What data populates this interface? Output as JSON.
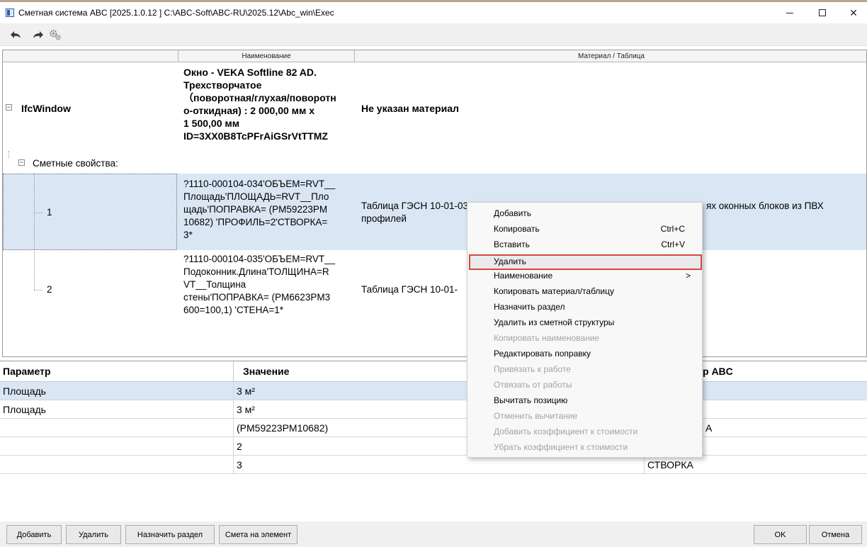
{
  "window": {
    "title": "Сметная система ABC [2025.1.0.12 ]   C:\\ABC-Soft\\ABC-RU\\2025.12\\Abc_win\\Exec",
    "app_icon": "abc-app-icon"
  },
  "toolbar": {
    "icons": [
      "undo-arrow-icon",
      "redo-arrow-icon",
      "gears-icon"
    ]
  },
  "tree_grid": {
    "columns": [
      "",
      "Наименование",
      "Материал / Таблица"
    ],
    "root": {
      "label": "IfcWindow",
      "name": "Окно - VEKA Softline 82 AD. Трехстворчатое (поворотная/глухая/поворотно-откидная) : 2 000,00 мм x 1 500,00 мм ID=3XX0B8TcPFrAiGSrVtTTMZ",
      "name_lines": [
        "Окно - VEKA Softline 82 AD.",
        "Трехстворчатое",
        "（поворотная/глухая/поворотн",
        "о-откидная) : 2 000,00 мм x",
        "1 500,00 мм",
        "ID=3XX0B8TcPFrAiGSrVtTTMZ"
      ],
      "material": "Не указан материал"
    },
    "group_label": "Сметные свойства:",
    "rows": [
      {
        "index": "1",
        "name_lines": [
          "?1110-000104-034'ОБЪЕМ=RVT__",
          "Площадь'ПЛОЩАДЬ=RVT__Пло",
          "щадь'ПОПРАВКА= (PM59223PM",
          "10682) 'ПРОФИЛЬ=2'СТВОРКА=",
          "3*"
        ],
        "material_lines": [
          "Таблица ГЭСН 10-01-034. У",
          "профилей"
        ],
        "material_right": "ях оконных блоков из ПВХ"
      },
      {
        "index": "2",
        "name_lines": [
          "?1110-000104-035'ОБЪЕМ=RVT__",
          "Подоконник.Длина'ТОЛЩИНА=R",
          "VT__Толщина",
          "стены'ПОПРАВКА= (PM6623PM3",
          "600=100,1) 'СТЕНА=1*"
        ],
        "material_lines": [
          "Таблица ГЭСН 10-01-"
        ]
      }
    ]
  },
  "param_grid": {
    "columns": [
      "Параметр",
      "Значение",
      "р ABC"
    ],
    "rows": [
      {
        "param": "Площадь",
        "value": "3 м²",
        "abc": ""
      },
      {
        "param": "Площадь",
        "value": "3 м²",
        "abc": ""
      },
      {
        "param": "",
        "value": " (PM59223PM10682)",
        "abc": "А"
      },
      {
        "param": "",
        "value": "2",
        "abc": ""
      },
      {
        "param": "",
        "value": "3",
        "abc": "СТВОРКА"
      }
    ]
  },
  "buttons": {
    "add": "Добавить",
    "delete": "Удалить",
    "assign_section": "Назначить раздел",
    "estimate_for_element": "Смета на элемент",
    "ok": "OK",
    "cancel": "Отмена"
  },
  "context_menu": {
    "items": [
      {
        "label": "Добавить",
        "shortcut": "",
        "disabled": false
      },
      {
        "label": "Копировать",
        "shortcut": "Ctrl+C",
        "disabled": false
      },
      {
        "label": "Вставить",
        "shortcut": "Ctrl+V",
        "disabled": false
      },
      {
        "label": "Удалить",
        "shortcut": "",
        "disabled": false,
        "highlighted": true
      },
      {
        "label": "Наименование",
        "shortcut": "",
        "disabled": false,
        "submenu": true
      },
      {
        "label": "Копировать материал/таблицу",
        "shortcut": "",
        "disabled": false
      },
      {
        "label": "Назначить раздел",
        "shortcut": "",
        "disabled": false
      },
      {
        "label": "Удалить из сметной структуры",
        "shortcut": "",
        "disabled": false
      },
      {
        "label": "Копировать наименование",
        "shortcut": "",
        "disabled": true
      },
      {
        "label": "Редактировать поправку",
        "shortcut": "",
        "disabled": false
      },
      {
        "label": "Привязать к работе",
        "shortcut": "",
        "disabled": true
      },
      {
        "label": "Отвязать от работы",
        "shortcut": "",
        "disabled": true
      },
      {
        "label": "Вычитать позицию",
        "shortcut": "",
        "disabled": false
      },
      {
        "label": "Отменить вычитание",
        "shortcut": "",
        "disabled": true
      },
      {
        "label": "Добавить коэффициент к стоимости",
        "shortcut": "",
        "disabled": true
      },
      {
        "label": "Убрать коэффициент к стоимости",
        "shortcut": "",
        "disabled": true
      }
    ],
    "submenu_arrow": ">"
  },
  "colors": {
    "selection": "#dae6f4",
    "highlight_border": "#d9473f",
    "disabled_text": "#a3a3a3"
  }
}
